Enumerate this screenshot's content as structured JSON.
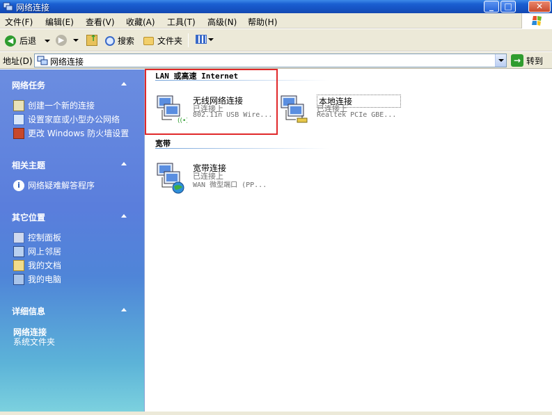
{
  "window": {
    "title": "网络连接"
  },
  "menu": [
    "文件(F)",
    "编辑(E)",
    "查看(V)",
    "收藏(A)",
    "工具(T)",
    "高级(N)",
    "帮助(H)"
  ],
  "toolbar": {
    "back": "后退",
    "search": "搜索",
    "folders": "文件夹"
  },
  "address": {
    "label": "地址(D)",
    "value": "网络连接",
    "go": "转到"
  },
  "left": {
    "network_tasks": {
      "title": "网络任务",
      "items": [
        "创建一个新的连接",
        "设置家庭或小型办公网络",
        "更改 Windows 防火墙设置"
      ]
    },
    "related": {
      "title": "相关主题",
      "items": [
        "网络疑难解答程序"
      ]
    },
    "other": {
      "title": "其它位置",
      "items": [
        "控制面板",
        "网上邻居",
        "我的文档",
        "我的电脑"
      ]
    },
    "details": {
      "title": "详细信息",
      "name": "网络连接",
      "type": "系统文件夹"
    }
  },
  "main": {
    "lan_group": "LAN 或高速 Internet",
    "broadband_group": "宽带",
    "connections": [
      {
        "name": "无线网络连接",
        "status": "已连接上",
        "device": "802.11n USB Wire..."
      },
      {
        "name": "本地连接",
        "status": "已连接上",
        "device": "Realtek PCIe GBE..."
      },
      {
        "name": "宽带连接",
        "status": "已连接上",
        "device": "WAN 微型端口 (PP..."
      }
    ]
  }
}
